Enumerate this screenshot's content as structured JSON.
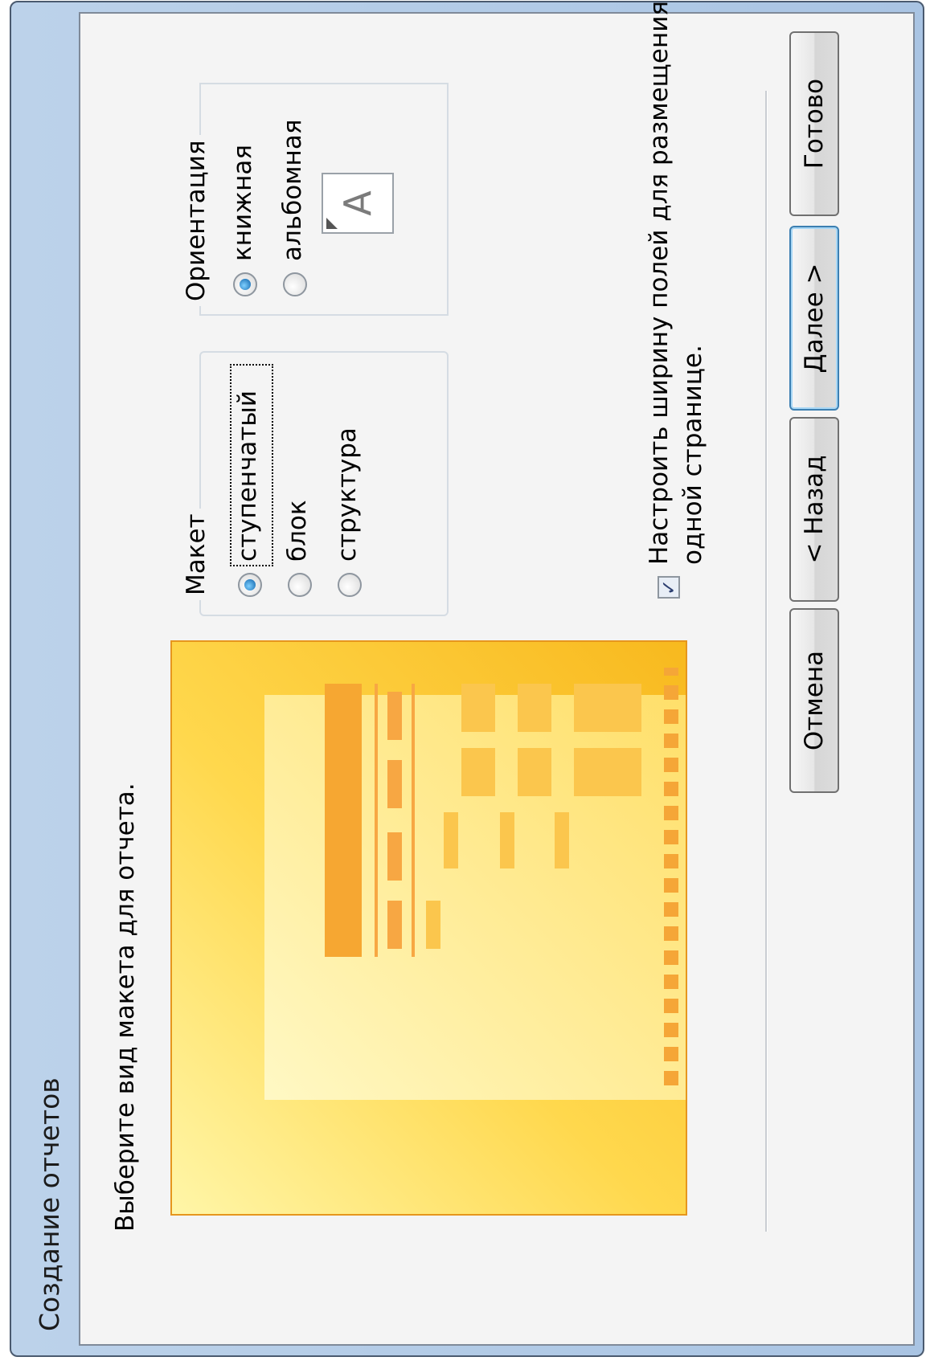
{
  "window": {
    "title": "Создание отчетов"
  },
  "prompt": "Выберите вид макета для отчета.",
  "layout_group": {
    "title": "Макет",
    "options": [
      "ступенчатый",
      "блок",
      "структура"
    ],
    "selected": "ступенчатый"
  },
  "orientation_group": {
    "title": "Ориентация",
    "options": [
      "книжная",
      "альбомная"
    ],
    "selected": "книжная",
    "icon_letter": "A"
  },
  "fit_fields_checkbox": {
    "checked": true,
    "line1": "Настроить ширину полей для размещения на",
    "line2": "одной странице."
  },
  "buttons": {
    "cancel": "Отмена",
    "back": "< Назад",
    "next": "Далее >",
    "finish": "Готово"
  },
  "colors": {
    "accent": "#3c7fb1",
    "preview_orange": "#f6a732",
    "preview_yellow": "#ffd84d"
  }
}
